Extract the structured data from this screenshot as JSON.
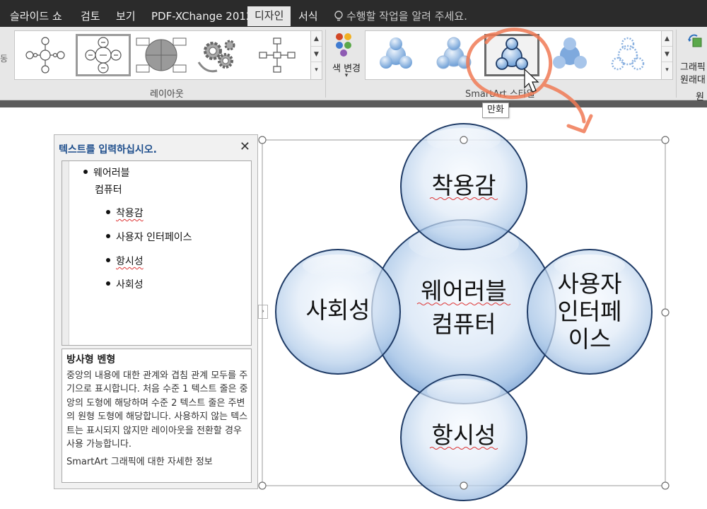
{
  "tabs": [
    {
      "label": "슬라이드 쇼",
      "active": false
    },
    {
      "label": "검토",
      "active": false
    },
    {
      "label": "보기",
      "active": false
    },
    {
      "label": "PDF-XChange 2012",
      "active": false
    },
    {
      "label": "디자인",
      "active": true
    },
    {
      "label": "서식",
      "active": false
    }
  ],
  "tell_me": "수행할 작업을 알려 주세요.",
  "ribbon": {
    "layout_group_label": "레이아웃",
    "color_button_label": "색 변경",
    "styles_group_label": "SmartArt 스타일",
    "right_partial": [
      "그래픽",
      "원래대",
      "원"
    ],
    "left_partial": "동"
  },
  "tooltip": "만화",
  "text_pane": {
    "title": "텍스트를 입력하십시오.",
    "items": [
      {
        "text": "웨어러블",
        "level": 1
      },
      {
        "text": "컴퓨터",
        "level": 1,
        "continuation": true
      },
      {
        "text": "착용감",
        "level": 2
      },
      {
        "text": "사용자 인터페이스",
        "level": 2
      },
      {
        "text": "항시성",
        "level": 2
      },
      {
        "text": "사회성",
        "level": 2
      }
    ],
    "description_title": "방사형 벤형",
    "description": "중앙의 내용에 대한 관계와 겹침 관계 모두를 주기으로 표시합니다. 처음 수준 1 텍스트 줄은 중앙의 도형에 해당하며 수준 2 텍스트 줄은 주변의 원형 도형에 해당합니다. 사용하지 않는 텍스트는 표시되지 않지만 레이아웃을 전환할 경우 사용 가능합니다.",
    "more_info": "SmartArt 그래픽에 대한 자세한 정보"
  },
  "diagram": {
    "center": [
      "웨어러블",
      "컴퓨터"
    ],
    "top": "착용감",
    "right": [
      "사용자",
      "인터페",
      "이스"
    ],
    "bottom": "항시성",
    "left": "사회성"
  },
  "colors": {
    "tab_bar": "#2b2b2b",
    "ribbon": "#e7e7e7",
    "circle_edge": "#1f3b66",
    "circle_fill": "#bcd3ee",
    "annotation": "#f07a55",
    "pane_title": "#1e4e8c"
  }
}
